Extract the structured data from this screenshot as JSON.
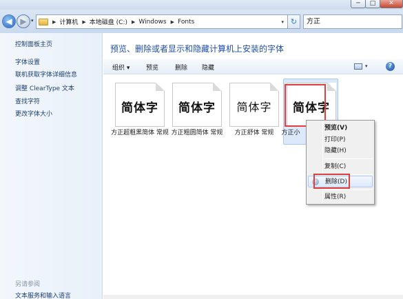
{
  "window": {
    "controls": {
      "minimize": "─",
      "maximize": "□",
      "close": "✕"
    }
  },
  "address": {
    "crumbs": [
      "计算机",
      "本地磁盘 (C:)",
      "Windows",
      "Fonts"
    ],
    "search_value": "方正"
  },
  "sidebar": {
    "items": [
      "控制面板主页",
      "字体设置",
      "联机获取字体详细信息",
      "调整 ClearType 文本",
      "查找字符",
      "更改字体大小"
    ],
    "see_also_header": "另请参阅",
    "see_also_items": [
      "文本服务和输入语言"
    ]
  },
  "main": {
    "heading": "预览、删除或者显示和隐藏计算机上安装的字体",
    "toolbar": {
      "organize": "组织 ▾",
      "preview": "预览",
      "delete": "删除",
      "hide": "隐藏"
    },
    "fonts": [
      {
        "sample": "简体字",
        "label": "方正超粗黑简体 常规"
      },
      {
        "sample": "简体字",
        "label": "方正粗圆简体 常规"
      },
      {
        "sample": "简体字",
        "label": "方正舒体 常规"
      },
      {
        "sample": "简体字",
        "label": "方正小"
      }
    ]
  },
  "context_menu": {
    "items": [
      {
        "label": "预览(V)",
        "default": true
      },
      {
        "label": "打印(P)"
      },
      {
        "label": "隐藏(H)"
      },
      {
        "label": "复制(C)"
      },
      {
        "label": "删除(D)",
        "highlighted": true
      },
      {
        "label": "属性(R)"
      }
    ]
  },
  "colors": {
    "annotation_red": "#e23c3c",
    "link_blue": "#1f4ea8",
    "selection": "#dbe9fb"
  }
}
